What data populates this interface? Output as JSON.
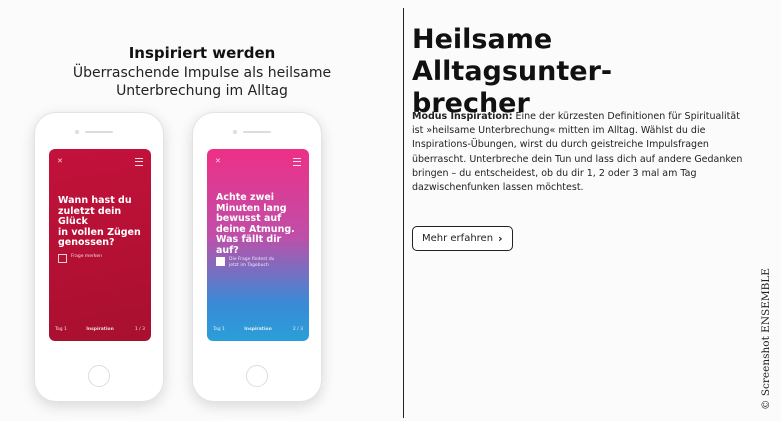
{
  "left": {
    "title": "Inspiriert werden",
    "subtitle": "Überraschende Impulse als heilsame\nUnterbrechung im Alltag"
  },
  "phones": [
    {
      "question": "Wann hast du\nzuletzt dein Glück\nin vollen Zügen\ngenossen?",
      "checkbox_text": "Frage merken",
      "bottom": {
        "left": "Tag 1",
        "center": "Inspiration",
        "right": "1 / 3"
      }
    },
    {
      "question": "Achte zwei\nMinuten lang\nbewusst auf\ndeine Atmung.\nWas fällt dir auf?",
      "checkbox_text": "Die Frage findest du\njetzt im Tagebuch",
      "bottom": {
        "left": "Tag 1",
        "center": "Inspiration",
        "right": "2 / 3"
      }
    }
  ],
  "right": {
    "headline": "Heilsame Alltagsunter-\nbrecher",
    "lead": "Modus Inspiration:",
    "body": " Eine der kürzesten Definitionen für Spiritualität ist »heilsame Unterbrechung« mitten im Alltag. Wählst du die Inspirations-Übungen, wirst du durch geistreiche Impulsfragen überrascht. Unterbreche dein Tun und lass dich auf andere Gedanken bringen – du entscheidest, ob du dir 1, 2 oder 3 mal am Tag dazwischenfunken lassen möchtest.",
    "button_label": "Mehr erfahren"
  },
  "credit": "© Screenshot ENSEMBLE",
  "colors": {
    "red_screen": "#b8103a",
    "pink": "#ee2f86",
    "blue": "#2a9fd9"
  },
  "icons": {
    "close": "close-icon",
    "menu": "menu-icon",
    "button": "chevron-right-icon"
  }
}
